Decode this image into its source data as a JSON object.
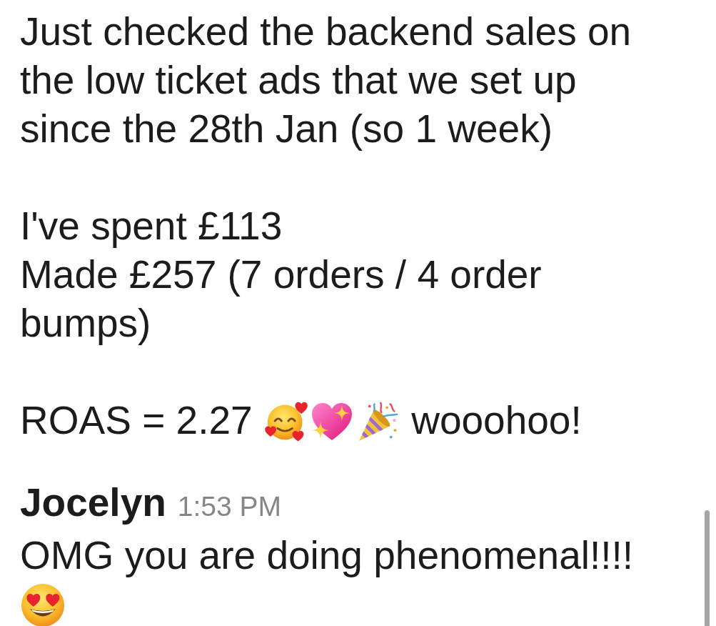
{
  "messages": [
    {
      "blocks": [
        {
          "lines": [
            {
              "parts": [
                {
                  "kind": "text",
                  "text": "Just checked the backend sales on the low ticket ads that we set up since the 28th Jan (so 1 week)"
                }
              ]
            }
          ]
        },
        {
          "lines": [
            {
              "parts": [
                {
                  "kind": "text",
                  "text": "I've spent £113"
                }
              ]
            },
            {
              "parts": [
                {
                  "kind": "text",
                  "text": "Made £257 (7 orders / 4 order bumps)"
                }
              ]
            }
          ]
        },
        {
          "lines": [
            {
              "parts": [
                {
                  "kind": "text",
                  "text": "ROAS = 2.27"
                },
                {
                  "kind": "blush"
                },
                {
                  "kind": "sparkleheart"
                },
                {
                  "kind": "popper"
                },
                {
                  "kind": "text",
                  "text": "wooohoo!"
                }
              ]
            }
          ]
        }
      ]
    },
    {
      "author": "Jocelyn",
      "time": "1:53 PM",
      "blocks": [
        {
          "lines": [
            {
              "parts": [
                {
                  "kind": "text",
                  "text": "OMG you are doing phenomenal!!!!"
                },
                {
                  "kind": "hearteyes"
                }
              ]
            }
          ]
        }
      ]
    }
  ]
}
